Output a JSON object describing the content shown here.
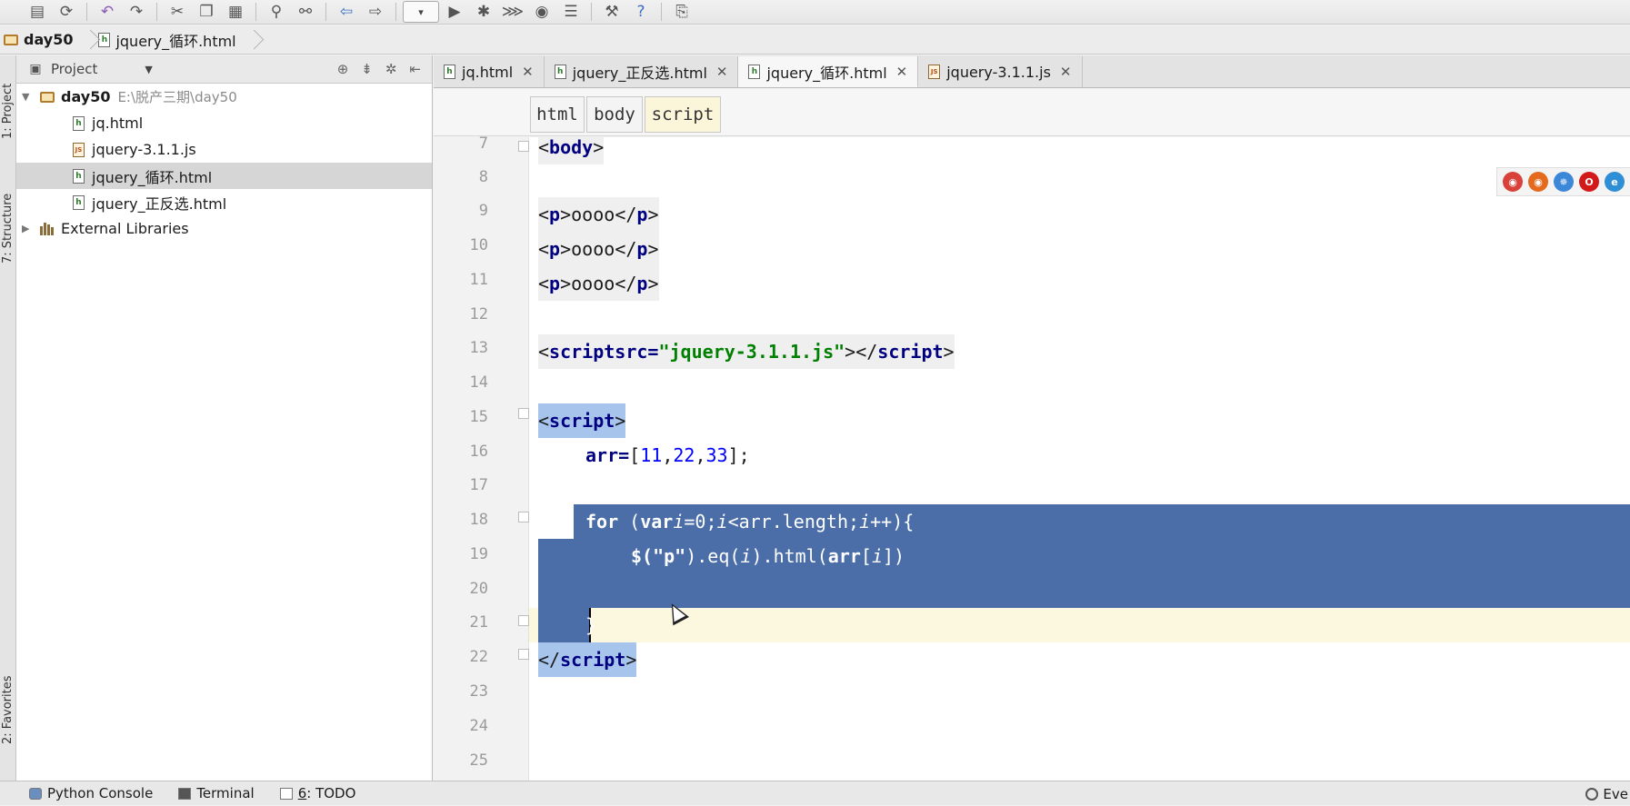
{
  "breadcrumb": {
    "folder": "day50",
    "file": "jquery_循环.html"
  },
  "left_strip": {
    "project_tab": "1: Project",
    "structure_tab": "7: Structure",
    "favorites_tab": "2: Favorites"
  },
  "project_panel": {
    "title": "Project",
    "tree": [
      {
        "label": "day50",
        "hint": "E:\\脱产三期\\day50",
        "type": "folder"
      },
      {
        "label": "jq.html",
        "type": "html"
      },
      {
        "label": "jquery-3.1.1.js",
        "type": "js"
      },
      {
        "label": "jquery_循环.html",
        "type": "html",
        "selected": true
      },
      {
        "label": "jquery_正反选.html",
        "type": "html"
      },
      {
        "label": "External Libraries",
        "type": "lib"
      }
    ]
  },
  "editor_tabs": [
    {
      "label": "jq.html",
      "type": "html"
    },
    {
      "label": "jquery_正反选.html",
      "type": "html"
    },
    {
      "label": "jquery_循环.html",
      "type": "html",
      "active": true
    },
    {
      "label": "jquery-3.1.1.js",
      "type": "js"
    }
  ],
  "tag_path": [
    "html",
    "body",
    "script"
  ],
  "line_numbers": [
    "7",
    "8",
    "9",
    "10",
    "11",
    "12",
    "13",
    "14",
    "15",
    "16",
    "17",
    "18",
    "19",
    "20",
    "21",
    "22",
    "23",
    "24",
    "25"
  ],
  "code": {
    "l7_tag": "body",
    "p_text": "oooo",
    "script_src_attr": "src=",
    "script_src_val": "\"jquery-3.1.1.js\"",
    "script_tag": "script",
    "arr_name": "arr=",
    "arr_open": "[",
    "arr_vals": [
      "11",
      "22",
      "33"
    ],
    "arr_close": "];",
    "for_kw": "for",
    "var_kw": "var",
    "for_i": "i",
    "for_init": "=0;",
    "for_cond_i": "i",
    "for_cond": "<arr.length;",
    "for_inc_i": "i",
    "for_inc": "++){",
    "l19_dollar": "$(",
    "l19_str": "\"p\"",
    "l19_eq": ").eq(",
    "l19_i": "i",
    "l19_html": ").html(",
    "l19_arr": "arr",
    "l19_idx_open": "[",
    "l19_i2": "i",
    "l19_end": "])",
    "l21_brace": "}"
  },
  "status_bar": {
    "python_console": "Python Console",
    "terminal": "Terminal",
    "todo_prefix": "6",
    "todo": ": TODO",
    "event": "Eve"
  },
  "colors": {
    "selection": "#4b6ea9",
    "tag_highlight": "#a7c4ec",
    "current_line": "#fbf8df"
  }
}
